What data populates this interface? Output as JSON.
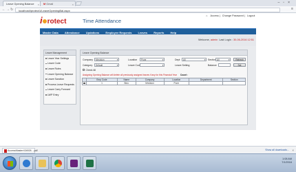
{
  "browser": {
    "tabs": [
      {
        "label": "Leave Opening Balance",
        "active": true
      },
      {
        "label": "Gmail",
        "active": false
      }
    ],
    "url": "localhost/iprotect1/LeaveOpeningBal.aspx"
  },
  "header": {
    "logo_i": "i",
    "logo_rest": "rotect",
    "app_title": "Time Attendance",
    "links": [
      "Home",
      "Access",
      "Change Password",
      "Logout"
    ]
  },
  "nav": {
    "items": [
      "Master Data",
      "Attendance",
      "Updations",
      "Employee Requests",
      "Leaves",
      "Reports",
      "Help"
    ]
  },
  "welcome": {
    "prefix": "Welcome,",
    "user": "admin",
    "last_login_label": "Last Login :",
    "last_login": "30-06-2016 12:51"
  },
  "sidebar": {
    "title": "Leave Management",
    "items": [
      "Leave Year Settings",
      "Leave Code",
      "Leave Rules",
      "Leave Opening Balance",
      "Leave Sanction",
      "Process Leave Requests",
      "Leave Carry Forward",
      "LWP Entry"
    ]
  },
  "panel": {
    "title": "Leave Opening Balance",
    "company_label": "Company",
    "company_value": "Mnvision",
    "location_label": "Location",
    "location_value": "Pune",
    "dept_label": "Dept",
    "dept_value": "All",
    "section_label": "Section",
    "section_value": "All",
    "refresh_label": "Refresh",
    "category_label": "Category",
    "category_value": "Default",
    "leave_code_label": "Leave Code",
    "leave_setting_label": "Leave Setting",
    "balance_label": "Balance",
    "set_label": "Set",
    "check_all_label": "Check All",
    "warning": "Assigning Opening Balance will delete all previously assigned leaves if any for this Financial Year",
    "count_label": "Count :"
  },
  "grid": {
    "columns": [
      "Emp Code",
      "Name",
      "Company",
      "Location",
      "Department",
      "Section"
    ],
    "rows": [
      {
        "emp_code": "1",
        "name": "Binu",
        "company": "Mnvision",
        "location": "Pune",
        "department": "",
        "section": ""
      }
    ]
  },
  "downloads": {
    "file": "AccessMaster434928....pdf",
    "show_all": "Show all downloads..."
  },
  "taskbar": {
    "time": "1:08 AM",
    "date": "7/1/2016"
  }
}
